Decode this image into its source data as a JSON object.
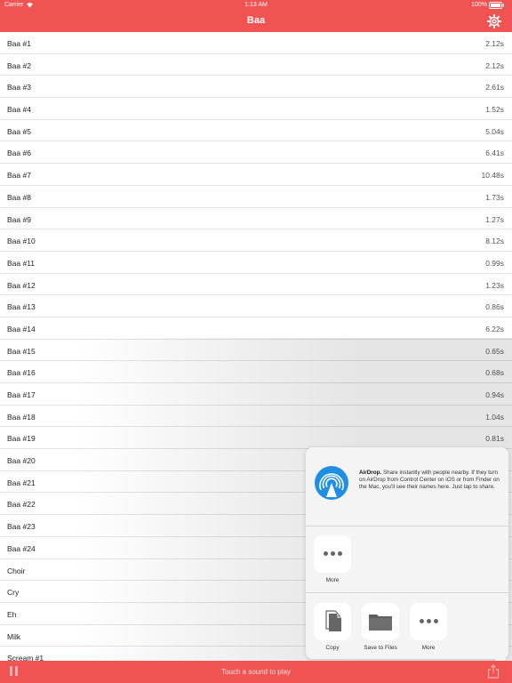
{
  "status": {
    "carrier": "Carrier",
    "time": "1:13 AM",
    "battery": "100%"
  },
  "nav": {
    "title": "Baa",
    "settings_icon": "gear-icon"
  },
  "sounds": [
    {
      "name": "Baa #1",
      "duration": "2.12s"
    },
    {
      "name": "Baa #2",
      "duration": "2.12s"
    },
    {
      "name": "Baa #3",
      "duration": "2.61s"
    },
    {
      "name": "Baa #4",
      "duration": "1.52s"
    },
    {
      "name": "Baa #5",
      "duration": "5.04s"
    },
    {
      "name": "Baa #6",
      "duration": "6.41s"
    },
    {
      "name": "Baa #7",
      "duration": "10.48s"
    },
    {
      "name": "Baa #8",
      "duration": "1.73s"
    },
    {
      "name": "Baa #9",
      "duration": "1.27s"
    },
    {
      "name": "Baa #10",
      "duration": "8.12s"
    },
    {
      "name": "Baa #11",
      "duration": "0.99s"
    },
    {
      "name": "Baa #12",
      "duration": "1.23s"
    },
    {
      "name": "Baa #13",
      "duration": "0.86s"
    },
    {
      "name": "Baa #14",
      "duration": "6.22s"
    },
    {
      "name": "Baa #15",
      "duration": "0.65s"
    },
    {
      "name": "Baa #16",
      "duration": "0.68s"
    },
    {
      "name": "Baa #17",
      "duration": "0.94s"
    },
    {
      "name": "Baa #18",
      "duration": "1.04s"
    },
    {
      "name": "Baa #19",
      "duration": "0.81s"
    },
    {
      "name": "Baa #20",
      "duration": ""
    },
    {
      "name": "Baa #21",
      "duration": ""
    },
    {
      "name": "Baa #22",
      "duration": ""
    },
    {
      "name": "Baa #23",
      "duration": ""
    },
    {
      "name": "Baa #24",
      "duration": ""
    },
    {
      "name": "Choir",
      "duration": ""
    },
    {
      "name": "Cry",
      "duration": ""
    },
    {
      "name": "Eh",
      "duration": ""
    },
    {
      "name": "Milk",
      "duration": ""
    },
    {
      "name": "Scream #1",
      "duration": ""
    }
  ],
  "share_sheet": {
    "airdrop_title": "AirDrop.",
    "airdrop_text": "Share instantly with people nearby. If they turn on AirDrop from Control Center on iOS or from Finder on the Mac, you'll see their names here. Just tap to share.",
    "more_top": "More",
    "copy": "Copy",
    "save_to_files": "Save to Files",
    "more_bottom": "More"
  },
  "toolbar": {
    "prompt": "Touch a sound to play"
  },
  "colors": {
    "accent": "#f05352",
    "airdrop_blue": "#1f8fe4"
  }
}
